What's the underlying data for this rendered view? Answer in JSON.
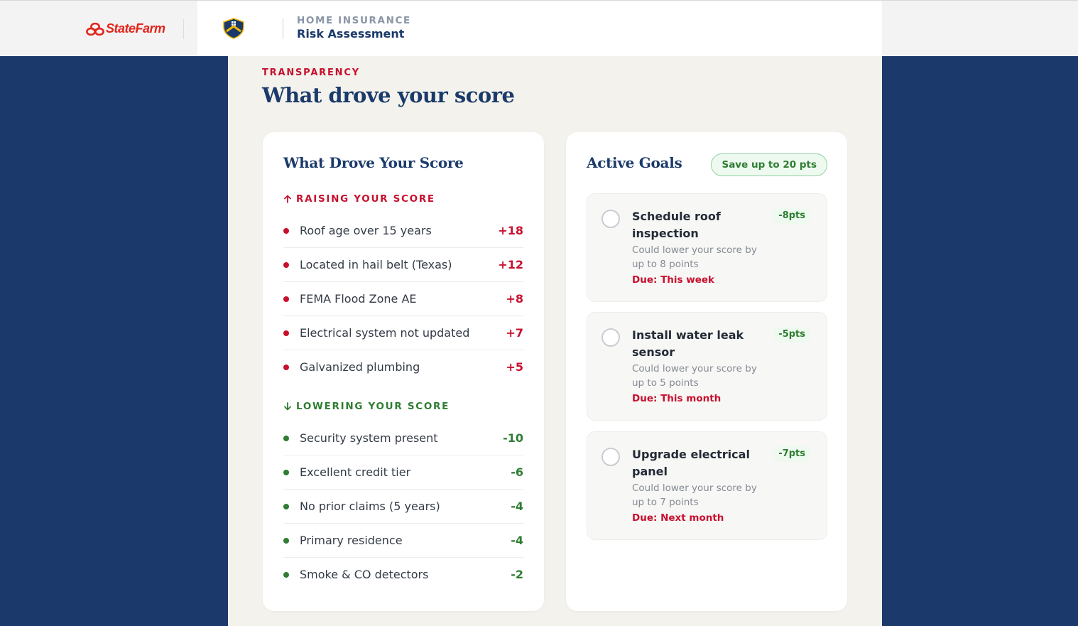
{
  "header": {
    "brand": "StateFarm",
    "eyebrow": "HOME INSURANCE",
    "title": "Risk Assessment"
  },
  "section": {
    "eyebrow": "TRANSPARENCY",
    "title": "What drove your score"
  },
  "drivers": {
    "title": "What Drove Your Score",
    "raising_label": "RAISING YOUR SCORE",
    "lowering_label": "LOWERING YOUR SCORE",
    "raising": [
      {
        "label": "Roof age over 15 years",
        "value": "+18"
      },
      {
        "label": "Located in hail belt (Texas)",
        "value": "+12"
      },
      {
        "label": "FEMA Flood Zone AE",
        "value": "+8"
      },
      {
        "label": "Electrical system not updated",
        "value": "+7"
      },
      {
        "label": "Galvanized plumbing",
        "value": "+5"
      }
    ],
    "lowering": [
      {
        "label": "Security system present",
        "value": "-10"
      },
      {
        "label": "Excellent credit tier",
        "value": "-6"
      },
      {
        "label": "No prior claims (5 years)",
        "value": "-4"
      },
      {
        "label": "Primary residence",
        "value": "-4"
      },
      {
        "label": "Smoke & CO detectors",
        "value": "-2"
      }
    ]
  },
  "goals": {
    "title": "Active Goals",
    "badge": "Save up to 20 pts",
    "items": [
      {
        "title": "Schedule roof inspection",
        "points": "-8pts",
        "desc": "Could lower your score by up to 8 points",
        "due": "Due: This week"
      },
      {
        "title": "Install water leak sensor",
        "points": "-5pts",
        "desc": "Could lower your score by up to 5 points",
        "due": "Due: This month"
      },
      {
        "title": "Upgrade electrical panel",
        "points": "-7pts",
        "desc": "Could lower your score by up to 7 points",
        "due": "Due: Next month"
      }
    ]
  },
  "colors": {
    "navy": "#1b3a6b",
    "red": "#c8102e",
    "green": "#2e7d32",
    "panel": "#f3f2ec"
  }
}
